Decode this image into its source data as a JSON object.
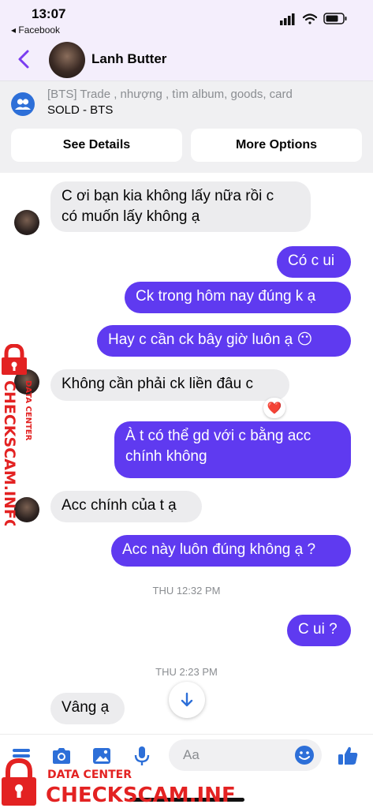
{
  "status_bar": {
    "time": "13:07",
    "back_app": "◂ Facebook"
  },
  "header": {
    "contact_name": "Lanh Butter"
  },
  "group": {
    "subtitle": "[BTS] Trade , nhượng , tìm album, goods, card",
    "title": "SOLD - BTS",
    "see_details": "See Details",
    "more_options": "More Options"
  },
  "messages": [
    {
      "from": "them",
      "text_line1": "C ơi bạn kia không lấy nữa rồi c",
      "text_line2": "có muốn lấy không ạ"
    },
    {
      "from": "me",
      "text": "Có c ui"
    },
    {
      "from": "me",
      "text": "Ck trong hôm nay đúng k ạ"
    },
    {
      "from": "me",
      "text": "Hay c cần ck bây giờ luôn ạ 😶"
    },
    {
      "from": "them",
      "text": "Không cần phải ck liền đâu c",
      "reaction": "❤️"
    },
    {
      "from": "me",
      "text_line1": "À t có thể gd với c bằng acc",
      "text_line2": "chính không"
    },
    {
      "from": "them",
      "text": "Acc chính của t ạ"
    },
    {
      "from": "me",
      "text": "Acc này luôn đúng không ạ ?"
    },
    {
      "from": "me",
      "text": "C ui ?"
    },
    {
      "from": "them",
      "text": "Vâng ạ"
    }
  ],
  "timestamps": [
    "THU 12:32 PM",
    "THU 2:23 PM"
  ],
  "composer": {
    "placeholder": "Aa"
  },
  "watermark": {
    "side_line1": "CHECKSCAM.INFO",
    "side_line2": "DATA CENTER",
    "bottom_line1": "DATA CENTER",
    "bottom_line2": "CHECKSCAM.INFO"
  },
  "colors": {
    "accent": "#5f3af0",
    "incoming": "#ececee",
    "header_bg": "#f4eefc",
    "watermark": "#e32222"
  }
}
